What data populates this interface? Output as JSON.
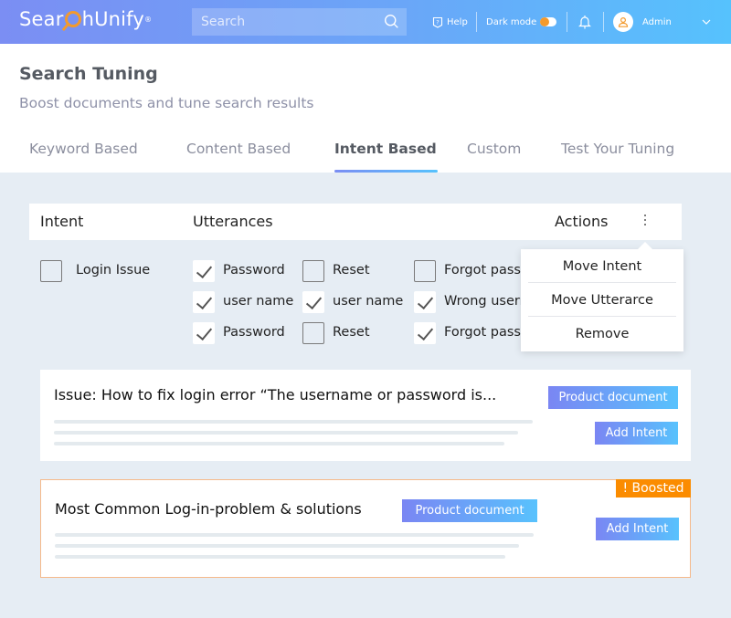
{
  "header": {
    "logo_left": "Sear",
    "logo_right": "hUnify",
    "logo_mark": "®",
    "search_placeholder": "Search",
    "help_label": "Help",
    "dark_mode_label": "Dark mode",
    "dark_mode_on": false,
    "user_name": "Admin",
    "accent_color": "#f39a2d"
  },
  "page": {
    "title": "Search Tuning",
    "subtitle": "Boost documents and tune search results"
  },
  "tabs": [
    {
      "label": "Keyword Based",
      "active": false
    },
    {
      "label": "Content Based",
      "active": false
    },
    {
      "label": "Intent Based",
      "active": true
    },
    {
      "label": "Custom",
      "active": false
    },
    {
      "label": "Test Your Tuning",
      "active": false
    }
  ],
  "table": {
    "headers": {
      "intent": "Intent",
      "utterances": "Utterances",
      "actions": "Actions"
    },
    "intent": {
      "label": "Login Issue",
      "checked": false
    },
    "utterances": [
      [
        {
          "label": "Password",
          "checked": true
        },
        {
          "label": "Reset",
          "checked": false
        },
        {
          "label": "Forgot password",
          "checked": false
        }
      ],
      [
        {
          "label": "user name",
          "checked": true
        },
        {
          "label": "user name",
          "checked": true
        },
        {
          "label": "Wrong username",
          "checked": true
        }
      ],
      [
        {
          "label": "Password",
          "checked": true
        },
        {
          "label": "Reset",
          "checked": false
        },
        {
          "label": "Forgot password",
          "checked": true
        }
      ]
    ]
  },
  "actions_menu": [
    {
      "label": "Move Intent"
    },
    {
      "label": "Move Utterarce"
    },
    {
      "label": "Remove"
    }
  ],
  "results": [
    {
      "title": "Issue: How to fix login error “The username or password is...",
      "doc_type": "Product document",
      "action": "Add Intent",
      "boosted": false
    },
    {
      "title": "Most Common Log-in-problem & solutions",
      "doc_type": "Product document",
      "action": "Add Intent",
      "boosted": true,
      "boost_label": "! Boosted",
      "boost_color": "#fb8c00"
    }
  ]
}
